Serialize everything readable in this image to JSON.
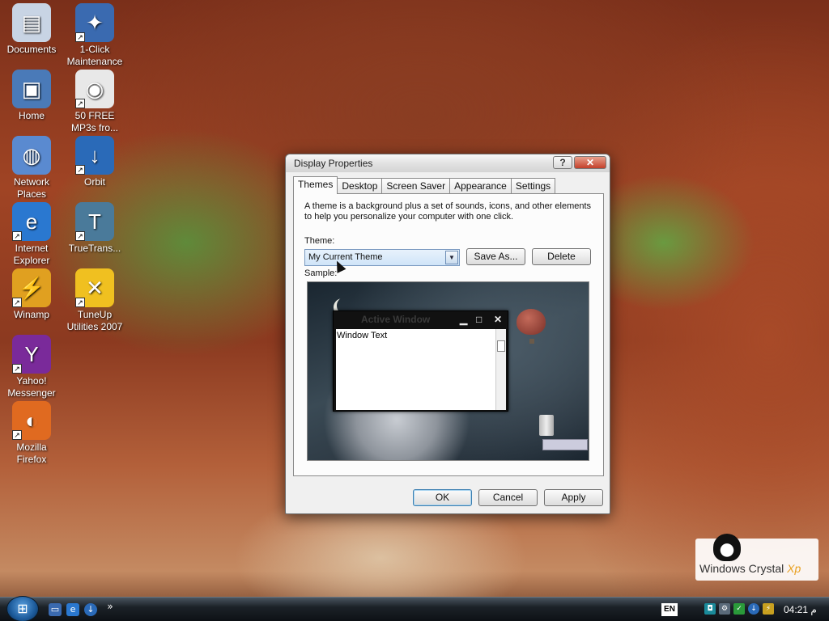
{
  "desktop": {
    "icons": [
      {
        "label": "Documents",
        "icon": "folder-icon",
        "color": "#c8d4e4"
      },
      {
        "label": "1-Click\nMaintenance",
        "icon": "maintenance-icon",
        "color": "#3a6ab0"
      },
      {
        "label": "Home",
        "icon": "computer-icon",
        "color": "#4a7ab8"
      },
      {
        "label": "50 FREE\nMP3s fro...",
        "icon": "mp3-disc-icon",
        "color": "#e8e8e8"
      },
      {
        "label": "Network\nPlaces",
        "icon": "network-globe-icon",
        "color": "#5a8ad0"
      },
      {
        "label": "Orbit",
        "icon": "download-arrow-icon",
        "color": "#2a6ab8"
      },
      {
        "label": "Internet\nExplorer",
        "icon": "internet-explorer-icon",
        "color": "#2a78d0"
      },
      {
        "label": "TrueTrans...",
        "icon": "truetrans-icon",
        "color": "#4a7a9a"
      },
      {
        "label": "Winamp",
        "icon": "winamp-icon",
        "color": "#e0a020"
      },
      {
        "label": "TuneUp\nUtilities 2007",
        "icon": "tuneup-icon",
        "color": "#f0c020"
      },
      {
        "label": "Yahoo!\nMessenger",
        "icon": "yahoo-messenger-icon",
        "color": "#7a2a9a"
      },
      {
        "label": "Mozilla\nFirefox",
        "icon": "firefox-icon",
        "color": "#e06a20"
      }
    ]
  },
  "dialog": {
    "title": "Display Properties",
    "help_glyph": "?",
    "close_glyph": "✕",
    "tabs": [
      {
        "label": "Themes",
        "active": true
      },
      {
        "label": "Desktop"
      },
      {
        "label": "Screen Saver"
      },
      {
        "label": "Appearance"
      },
      {
        "label": "Settings"
      }
    ],
    "description": "A theme is a background plus a set of sounds, icons, and other elements to help you personalize your computer with one click.",
    "theme_label": "Theme:",
    "theme_value": "My Current Theme",
    "save_as_label": "Save As...",
    "delete_label": "Delete",
    "sample_label": "Sample:",
    "sample_window": {
      "title": "Active Window",
      "text": "Window Text"
    },
    "ok_label": "OK",
    "cancel_label": "Cancel",
    "apply_label": "Apply"
  },
  "taskbar": {
    "start_glyph": "⊞",
    "quick_launch_more": "»",
    "language": "EN",
    "clock": "04:21 م"
  },
  "badge": {
    "brand": "Windows Crystal",
    "suffix": "Xp"
  },
  "colors": {
    "accent": "#3c7fb1",
    "close_red": "#c4402a"
  }
}
